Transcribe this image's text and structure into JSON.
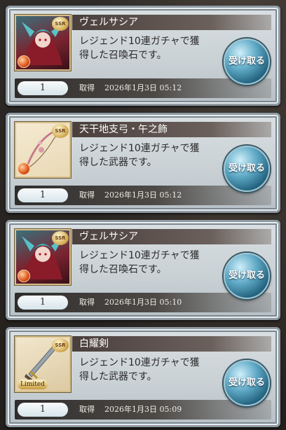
{
  "items": [
    {
      "name": "ヴェルサシア",
      "description_line1": "レジェンド10連ガチャで獲",
      "description_line2": "得した召喚石です。",
      "count": "1",
      "acquired_label": "取得",
      "date": "2026年1月3日 05:12",
      "button_label": "受け取る",
      "rarity": "SSR",
      "thumb_type": "summon"
    },
    {
      "name": "天干地支弓・午之飾",
      "description_line1": "レジェンド10連ガチャで獲",
      "description_line2": "得した武器です。",
      "count": "1",
      "acquired_label": "取得",
      "date": "2026年1月3日 05:12",
      "button_label": "受け取る",
      "rarity": "SSR",
      "thumb_type": "weapon"
    },
    {
      "name": "ヴェルサシア",
      "description_line1": "レジェンド10連ガチャで獲",
      "description_line2": "得した召喚石です。",
      "count": "1",
      "acquired_label": "取得",
      "date": "2026年1月3日 05:10",
      "button_label": "受け取る",
      "rarity": "SSR",
      "thumb_type": "summon"
    },
    {
      "name": "白耀剣",
      "description_line1": "レジェンド10連ガチャで獲",
      "description_line2": "得した武器です。",
      "count": "1",
      "acquired_label": "取得",
      "date": "2026年1月3日 05:09",
      "button_label": "受け取る",
      "rarity": "SSR",
      "badge": "Limited",
      "thumb_type": "weapon2"
    }
  ],
  "colors": {
    "button_blue": "#23637f",
    "name_bar": "#4a3f3b",
    "card_bg": "#d9dfe2"
  }
}
